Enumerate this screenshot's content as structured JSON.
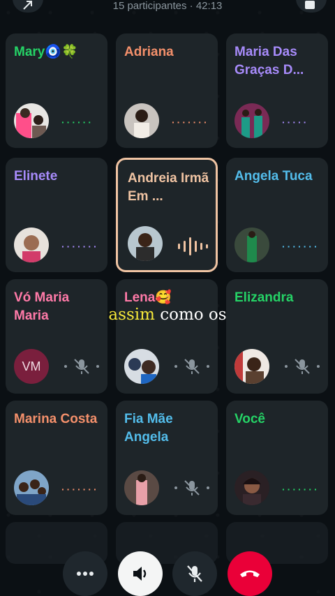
{
  "header": {
    "subtitle": "15 participantes · 42:13"
  },
  "participants": [
    {
      "name": "Mary🧿🍀",
      "name_color": "#25d366",
      "status": "speaking-dots",
      "status_color": "#25d366"
    },
    {
      "name": "Adriana",
      "name_color": "#f4906b",
      "status": "speaking-dots",
      "status_color": "#f4906b"
    },
    {
      "name": "Maria Das Graças D...",
      "name_color": "#a78bfa",
      "status": "speaking-dots",
      "status_color": "#a78bfa"
    },
    {
      "name": "Elinete",
      "name_color": "#a78bfa",
      "status": "speaking-dots",
      "status_color": "#a78bfa"
    },
    {
      "name": "Andreia Irmã Em ...",
      "name_color": "#f0c4a3",
      "status": "active-speaker",
      "status_color": "#f0c4a3"
    },
    {
      "name": "Angela Tuca",
      "name_color": "#53bdeb",
      "status": "speaking-dots",
      "status_color": "#53bdeb"
    },
    {
      "name": "Vó Maria Maria",
      "name_color": "#ff7aa8",
      "status": "muted",
      "initials": "VM",
      "avatar_color": "#7a1f3d"
    },
    {
      "name": "Lena🥰",
      "name_color": "#ff7aa8",
      "status": "muted"
    },
    {
      "name": "Elizandra",
      "name_color": "#25d366",
      "status": "muted"
    },
    {
      "name": "Marina Costa",
      "name_color": "#f4906b",
      "status": "speaking-dots",
      "status_color": "#f4906b"
    },
    {
      "name": "Fia Mãe Angela",
      "name_color": "#53bdeb",
      "status": "muted"
    },
    {
      "name": "Você",
      "name_color": "#25d366",
      "status": "speaking-dots",
      "status_color": "#25d366"
    }
  ],
  "caption": {
    "highlight": "assim",
    "rest": " como os"
  },
  "controls": {
    "more_icon": "more-horizontal-icon",
    "speaker_icon": "speaker-icon",
    "mic_icon": "mic-off-icon",
    "end_icon": "end-call-icon",
    "end_color": "#ea0038"
  },
  "colors": {
    "tile_bg": "#1e2529",
    "active_border": "#f0c4a3",
    "muted_icon": "#8b969e"
  }
}
